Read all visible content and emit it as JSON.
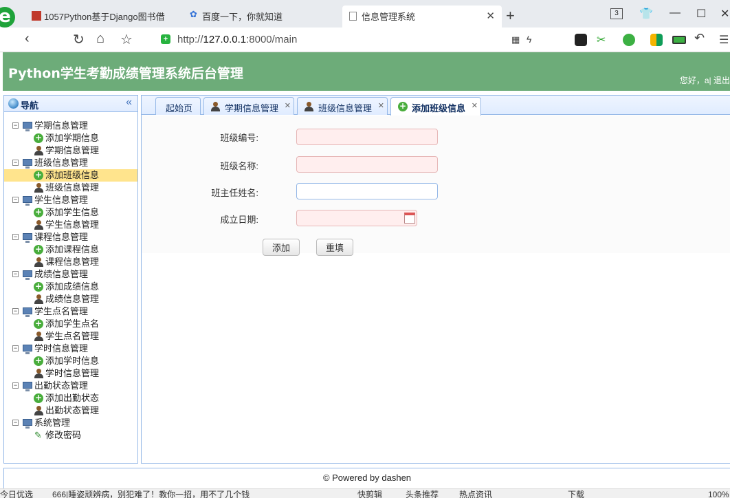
{
  "browser": {
    "tabs": [
      {
        "title": "1057Python基于Django图书借"
      },
      {
        "title": "百度一下，你就知道"
      },
      {
        "title": "信息管理系统"
      }
    ],
    "tab_count": "3",
    "address": {
      "prefix": "http://",
      "host": "127.0.0.1",
      "rest": ":8000/main"
    }
  },
  "app": {
    "title": "Python学生考勤成绩管理系统后台管理",
    "user_info": "您好，a| 退出"
  },
  "sidebar": {
    "title": "导航",
    "groups": [
      {
        "label": "学期信息管理",
        "items": [
          "添加学期信息",
          "学期信息管理"
        ]
      },
      {
        "label": "班级信息管理",
        "items": [
          "添加班级信息",
          "班级信息管理"
        ]
      },
      {
        "label": "学生信息管理",
        "items": [
          "添加学生信息",
          "学生信息管理"
        ]
      },
      {
        "label": "课程信息管理",
        "items": [
          "添加课程信息",
          "课程信息管理"
        ]
      },
      {
        "label": "成绩信息管理",
        "items": [
          "添加成绩信息",
          "成绩信息管理"
        ]
      },
      {
        "label": "学生点名管理",
        "items": [
          "添加学生点名",
          "学生点名管理"
        ]
      },
      {
        "label": "学时信息管理",
        "items": [
          "添加学时信息",
          "学时信息管理"
        ]
      },
      {
        "label": "出勤状态管理",
        "items": [
          "添加出勤状态",
          "出勤状态管理"
        ]
      },
      {
        "label": "系统管理",
        "items": [
          "修改密码"
        ]
      }
    ],
    "selected_item": "添加班级信息"
  },
  "tabs": [
    {
      "label": "起始页"
    },
    {
      "label": "学期信息管理"
    },
    {
      "label": "班级信息管理"
    },
    {
      "label": "添加班级信息"
    }
  ],
  "form": {
    "fields": [
      {
        "label": "班级编号:",
        "value": ""
      },
      {
        "label": "班级名称:",
        "value": ""
      },
      {
        "label": "班主任姓名:",
        "value": ""
      },
      {
        "label": "成立日期:",
        "value": ""
      }
    ],
    "submit_label": "添加",
    "reset_label": "重填"
  },
  "footer": "© Powered by dashen",
  "statusbar": {
    "left": "今日优选",
    "news": "666|睡姿顽辨病，别犯难了！教你一招，用不了几个钱",
    "items": [
      "快剪辑",
      "头条推荐",
      "热点资讯",
      "下载",
      "100%"
    ]
  }
}
